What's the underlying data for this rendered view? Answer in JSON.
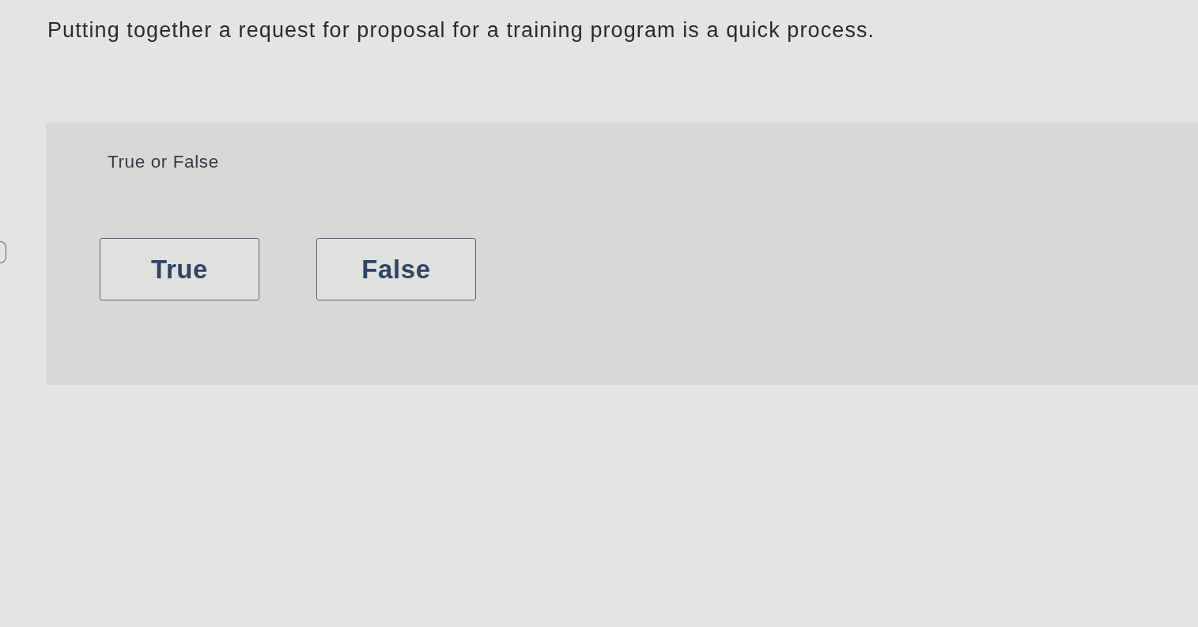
{
  "question": {
    "text": "Putting together a request for proposal for a training program is a quick process."
  },
  "answer_panel": {
    "prompt": "True or False",
    "options": [
      {
        "label": "True",
        "selected": false
      },
      {
        "label": "False",
        "selected": false
      }
    ]
  }
}
